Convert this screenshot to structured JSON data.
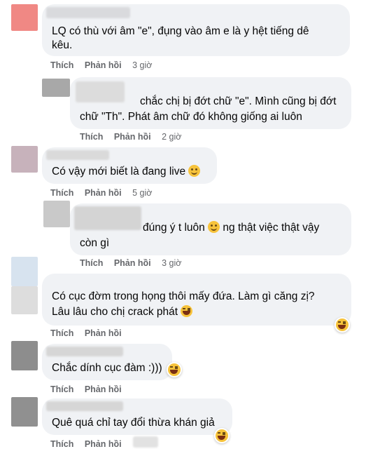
{
  "colors": {
    "bubble": "#f0f2f5",
    "action_text": "#65676b",
    "text": "#050505",
    "emoji": "#f7c33b"
  },
  "actions": {
    "like": "Thích",
    "reply": "Phản hồi"
  },
  "comments": [
    {
      "line1": "LQ có thù với âm \"e\", đụng vào âm e là y hệt tiếng dê",
      "line2": "kêu.",
      "time": "3 giờ",
      "avatar_color": "#f08884"
    },
    {
      "line1": "chắc chị bị đớt chữ \"e\". Mình cũng bị đớt",
      "line2": "chữ \"Th\". Phát âm chữ đó không giống ai luôn",
      "time": "2 giờ",
      "avatar_color": "#a8a8a8"
    },
    {
      "line1": "Có vậy mới biết là đang live",
      "emoji": "sweat-smile-icon",
      "time": "5 giờ",
      "avatar_color": "#c7b2bb"
    },
    {
      "line1a": "đúng ý t luôn",
      "line1b": "ng thật việc thật vậy",
      "line2": "còn gì",
      "emoji": "sweat-smile-icon",
      "time": "3 giờ",
      "avatar_color": "#c9c9c9"
    },
    {
      "line1": "Có cục đờm trong họng thôi mấy đứa. Làm gì căng zị?",
      "line2": "Lâu lâu cho chị crack phát",
      "emoji": "rofl-icon",
      "reaction": "haha-reaction-icon",
      "time": "",
      "avatar_color": "#d7e3ef"
    },
    {
      "line1": "Chắc dính cục đàm :)))",
      "emoji": "laughing-icon",
      "reaction": "haha-reaction-icon",
      "avatar_color": "#8d8d8d"
    },
    {
      "line1": "Quê quá chỉ tay đổi thừa khán giả",
      "reaction": "haha-reaction-icon",
      "avatar_color": "#909090"
    }
  ]
}
